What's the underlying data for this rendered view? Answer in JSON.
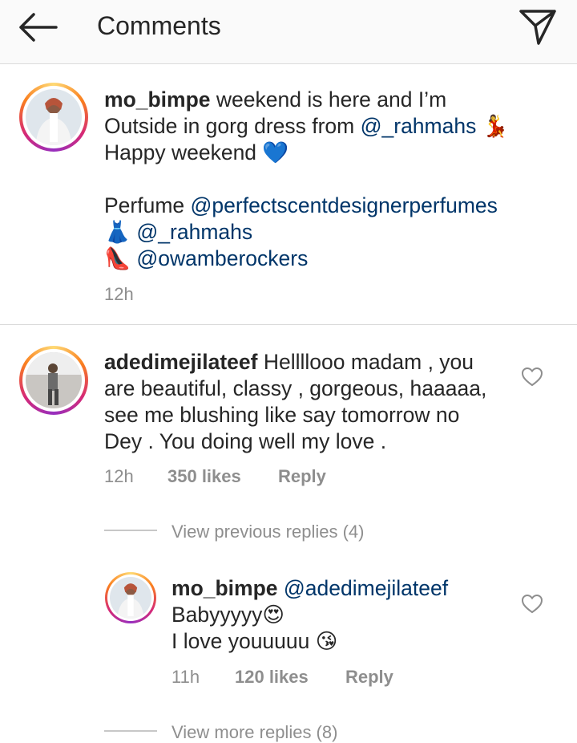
{
  "header": {
    "title": "Comments",
    "back_icon": "arrow-left-icon",
    "send_icon": "paper-plane-icon"
  },
  "caption": {
    "username": "mo_bimpe",
    "lines": [
      {
        "text": "weekend is here and I’m"
      },
      {
        "text": "Outside in gorg dress from ",
        "mention": "@_rahmahs",
        "emoji": "💃"
      },
      {
        "text": "Happy weekend ",
        "emoji": "💙"
      },
      {
        "text": "Perfume ",
        "mention": "@perfectscentdesignerperfumes"
      },
      {
        "emoji": "👗",
        "mention": "@_rahmahs"
      },
      {
        "emoji": "👠",
        "mention": "@owamberockers"
      }
    ],
    "time": "12h"
  },
  "comment": {
    "username": "adedimejilateef",
    "lines": [
      "Hellllooo madam , you",
      "are beautiful, classy , gorgeous, haaaaa,",
      "see me blushing like say tomorrow no",
      "Dey . You doing well my love ."
    ],
    "time": "12h",
    "likes": "350 likes",
    "reply_label": "Reply",
    "view_previous": "View previous replies (4)"
  },
  "reply": {
    "username": "mo_bimpe",
    "mention": "@adedimejilateef",
    "line1": "Babyyyyy",
    "line1_emoji": "😍",
    "line2": "I love youuuuu ",
    "line2_emoji": "😘",
    "time": "11h",
    "likes": "120 likes",
    "reply_label": "Reply",
    "view_more": "View more replies (8)"
  },
  "colors": {
    "text": "#262626",
    "mention": "#003569",
    "muted": "#8e8e8e",
    "divider": "#dbdbdb",
    "header_bg": "#fafafa"
  }
}
